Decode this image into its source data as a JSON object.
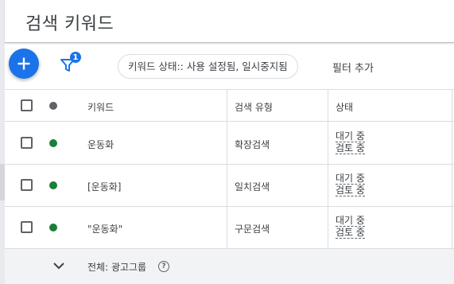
{
  "header": {
    "title": "검색 키워드"
  },
  "toolbar": {
    "add_icon": "plus-icon",
    "filter_icon": "filter-icon",
    "filter_count": "1",
    "chip_label": "키워드 상태:: 사용 설정됨, 일시중지됨",
    "add_filter_label": "필터 추가"
  },
  "table": {
    "columns": [
      "키워드",
      "검색 유형",
      "상태"
    ],
    "rows": [
      {
        "keyword": "운동화",
        "match_type": "확장검색",
        "status_line1": "대기 중",
        "status_line2": "검토 중"
      },
      {
        "keyword": "[운동화]",
        "match_type": "일치검색",
        "status_line1": "대기 중",
        "status_line2": "검토 중"
      },
      {
        "keyword": "\"운동화\"",
        "match_type": "구문검색",
        "status_line1": "대기 중",
        "status_line2": "검토 중"
      }
    ],
    "total_label": "전체: 광고그룹"
  },
  "colors": {
    "accent": "#1a73e8",
    "status_green": "#188038",
    "status_grey": "#5f6368"
  }
}
